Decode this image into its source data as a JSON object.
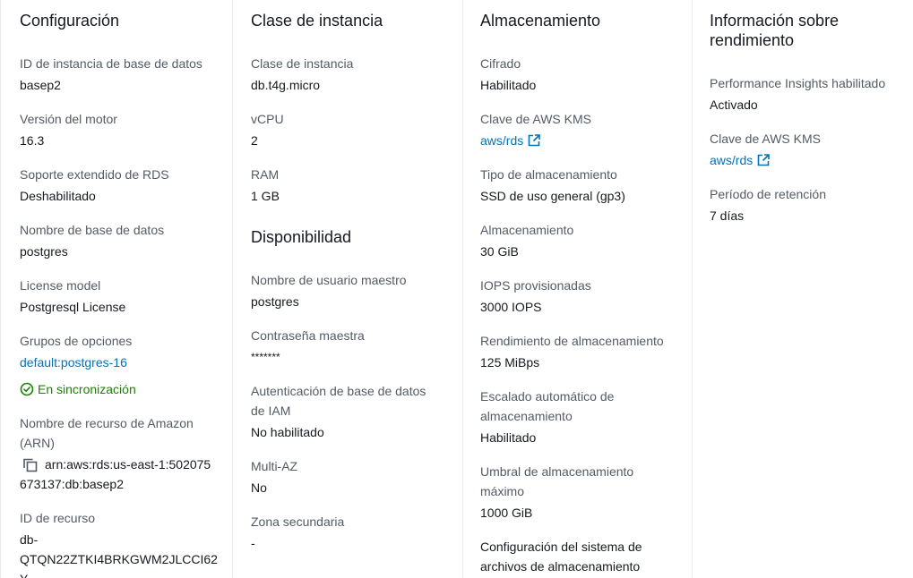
{
  "configuration": {
    "title": "Configuración",
    "fields": [
      {
        "label": "ID de instancia de base de datos",
        "value": "basep2"
      },
      {
        "label": "Versión del motor",
        "value": "16.3"
      },
      {
        "label": "Soporte extendido de RDS",
        "value": "Deshabilitado"
      },
      {
        "label": "Nombre de base de datos",
        "value": "postgres"
      },
      {
        "label": "License model",
        "value": "Postgresql License"
      }
    ],
    "option_groups": {
      "label": "Grupos de opciones",
      "link": "default:postgres-16",
      "status": "En sincronización"
    },
    "arn": {
      "label_line1": "Nombre de recurso de Amazon",
      "label_line2": "(ARN)",
      "value_line1": "arn:aws:rds:us-east-1:502075",
      "value_line2": "673137:db:basep2"
    },
    "resource_id": {
      "label": "ID de recurso",
      "value_line1": "db-",
      "value_line2": "QTQN22ZTKI4BRKGWM2JLCCI62",
      "value_line3": "Y"
    }
  },
  "instance_class": {
    "title": "Clase de instancia",
    "fields": [
      {
        "label": "Clase de instancia",
        "value": "db.t4g.micro"
      },
      {
        "label": "vCPU",
        "value": "2"
      },
      {
        "label": "RAM",
        "value": "1 GB"
      }
    ]
  },
  "availability": {
    "title": "Disponibilidad",
    "master_user": {
      "label": "Nombre de usuario maestro",
      "value": "postgres"
    },
    "master_password": {
      "label": "Contraseña maestra",
      "value": "*******"
    },
    "iam_auth": {
      "label_line1": "Autenticación de base de datos",
      "label_line2": "de IAM",
      "value": "No habilitado"
    },
    "multi_az": {
      "label": "Multi-AZ",
      "value": "No"
    },
    "secondary_zone": {
      "label": "Zona secundaria",
      "value": "-"
    }
  },
  "storage": {
    "title": "Almacenamiento",
    "encryption": {
      "label": "Cifrado",
      "value": "Habilitado"
    },
    "kms": {
      "label": "Clave de AWS KMS",
      "link": "aws/rds"
    },
    "storage_type": {
      "label": "Tipo de almacenamiento",
      "value": "SSD de uso general (gp3)"
    },
    "allocated": {
      "label": "Almacenamiento",
      "value": "30 GiB"
    },
    "iops": {
      "label": "IOPS provisionadas",
      "value": "3000 IOPS"
    },
    "throughput": {
      "label": "Rendimiento de almacenamiento",
      "value": "125 MiBps"
    },
    "autoscaling": {
      "label_line1": "Escalado automático de",
      "label_line2": "almacenamiento",
      "value": "Habilitado"
    },
    "max_threshold": {
      "label_line1": "Umbral de almacenamiento",
      "label_line2": "máximo",
      "value": "1000 GiB"
    },
    "fs_config": {
      "label_line1": "Configuración del sistema de",
      "label_line2": "archivos de almacenamiento"
    }
  },
  "performance": {
    "title_line1": "Información sobre",
    "title_line2": "rendimiento",
    "insights": {
      "label": "Performance Insights habilitado",
      "value": "Activado"
    },
    "kms": {
      "label": "Clave de AWS KMS",
      "link": "aws/rds"
    },
    "retention": {
      "label": "Período de retención",
      "value": "7 días"
    }
  },
  "colors": {
    "link": "#0073bb",
    "success": "#1d8102",
    "label": "#545b64",
    "text": "#16191f",
    "divider": "#e9ebed"
  },
  "icons": [
    "external-link-icon",
    "check-circle-icon",
    "copy-icon"
  ]
}
